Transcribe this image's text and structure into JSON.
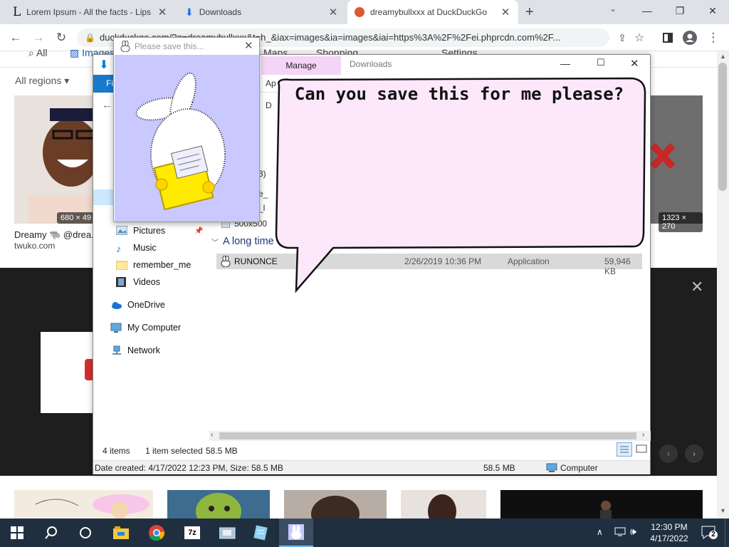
{
  "browser": {
    "tabs": [
      {
        "title": "Lorem Ipsum - All the facts - Lips",
        "icon": "letter-l-icon"
      },
      {
        "title": "Downloads",
        "icon": "download-icon"
      },
      {
        "title": "dreamybullxxx at DuckDuckGo",
        "icon": "duckduckgo-icon",
        "active": true
      }
    ],
    "new_tab": "+",
    "url": "duckduckgo.com/?q=dreamybullxxx&t=h_&iax=images&ia=images&iai=https%3A%2F%2Fei.phprcdn.com%2F..."
  },
  "ddg": {
    "tabs": [
      "All",
      "Images",
      "Maps",
      "Shopping",
      "Settings"
    ],
    "region": "All regions",
    "result1": {
      "dims": "680 × 49",
      "title": "Dreamy 🐃 @drea...",
      "source": "twuko.com"
    },
    "result2": {
      "dims": "1323 × 270"
    }
  },
  "explorer": {
    "tabs": {
      "manage": "Manage",
      "downloads": "Downloads"
    },
    "ribbon_file": "Fi",
    "ribbon_app": "Ap",
    "address_partial": "D",
    "files_partial": [
      "3)",
      "e_",
      "_l",
      "500x500"
    ],
    "group_header": "A long time",
    "file": {
      "name": "RUNONCE",
      "date": "2/26/2019 10:36 PM",
      "type": "Application",
      "size": "59,946 KB"
    },
    "nav": [
      {
        "label": "Pictures",
        "icon": "pictures-icon",
        "pinned": true
      },
      {
        "label": "Music",
        "icon": "music-icon"
      },
      {
        "label": "remember_me",
        "icon": "folder-icon"
      },
      {
        "label": "Videos",
        "icon": "videos-icon"
      },
      {
        "label": "OneDrive",
        "icon": "onedrive-icon"
      },
      {
        "label": "My Computer",
        "icon": "computer-icon"
      },
      {
        "label": "Network",
        "icon": "network-icon"
      }
    ],
    "status": {
      "items": "4 items",
      "selected": "1 item selected",
      "size": "58.5 MB"
    },
    "details": {
      "created": "Date created: 4/17/2022 12:23 PM, Size: 58.5 MB",
      "size": "58.5 MB",
      "location": "Computer"
    }
  },
  "bubble": {
    "text": "Can you save this for me please?"
  },
  "popup": {
    "title": "Please save this..."
  },
  "taskbar": {
    "time": "12:30 PM",
    "date": "4/17/2022",
    "notifications": "2",
    "apps": [
      "search-icon",
      "cortana-icon",
      "file-explorer-icon",
      "chrome-icon",
      "7zip-icon",
      "app-icon",
      "notepad-icon",
      "bunny-icon"
    ]
  },
  "colors": {
    "accent": "#0078d7",
    "taskbar": "#1f2f3f",
    "bubble": "#fde8fb",
    "popup_bg": "#c9c8ff",
    "folder": "#ffe14a"
  }
}
